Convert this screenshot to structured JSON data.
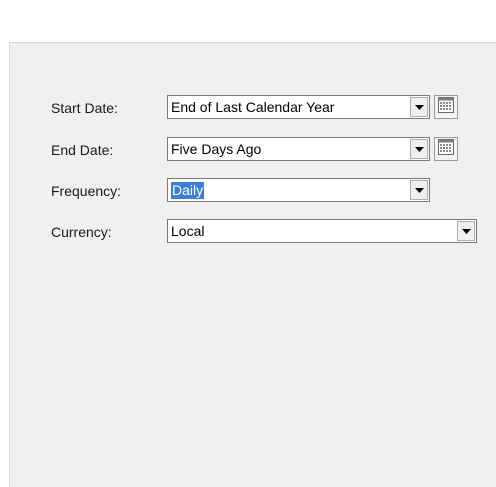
{
  "form": {
    "fields": [
      {
        "label": "Start Date:",
        "value": "End of Last Calendar Year",
        "has_calendar": true
      },
      {
        "label": "End Date:",
        "value": "Five Days Ago",
        "has_calendar": true
      },
      {
        "label": "Frequency:",
        "value": "Daily",
        "has_calendar": false,
        "selected": true
      },
      {
        "label": "Currency:",
        "value": "Local",
        "has_calendar": false
      }
    ]
  },
  "icons": {
    "dropdown": "chevron-down-icon",
    "calendar": "calendar-icon"
  },
  "colors": {
    "panel_bg": "#f0f0f0",
    "selection": "#3b7fd6"
  }
}
